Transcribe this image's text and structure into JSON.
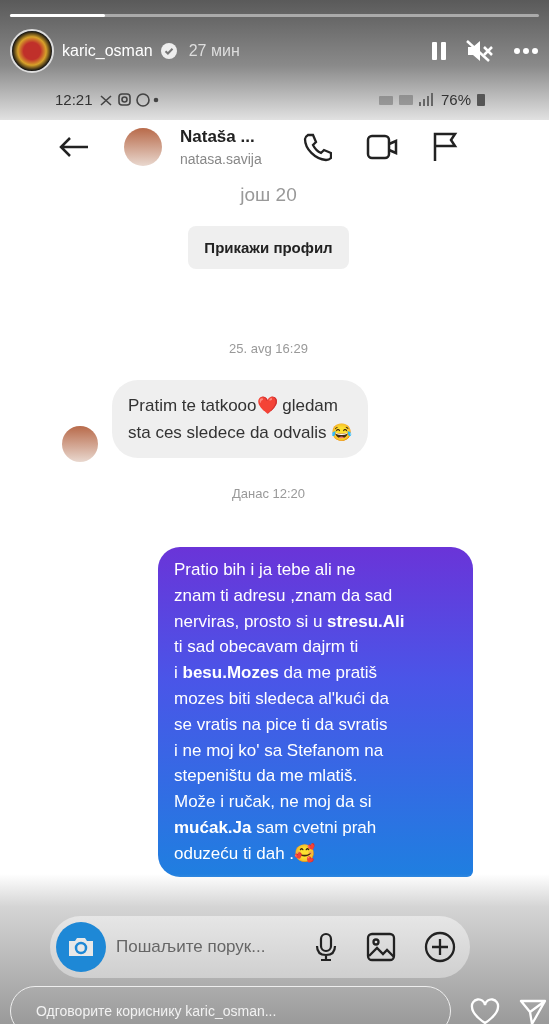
{
  "story": {
    "progress": {
      "level": 0.18
    },
    "username": "karic_osman",
    "verified": true,
    "time": "27 мин",
    "paused": false,
    "muted": true
  },
  "phone_status": {
    "time": "12:21",
    "battery": "76%"
  },
  "chat_header": {
    "name": "Nataša ...",
    "handle": "natasa.savija"
  },
  "profile_info": {
    "count": "још 20",
    "button": "Прикажи профил"
  },
  "messages": [
    {
      "kind": "date",
      "text": "25. avg 16:29"
    },
    {
      "kind": "incoming",
      "text": "Pratim te tatkooo❤️ gledam\nsta ces sledece da odvalis 😂"
    },
    {
      "kind": "date",
      "text": "Данас 12:20"
    },
    {
      "kind": "outgoing",
      "text": "Pratio bih i ja tebe ali ne\nznam ti adresu ,znam da  sad\nnerviras, prosto si u **stresu.Ali**\nti  sad obecavam dajrm  ti\ni **besu.Mozes** da me pratiš\nmozes biti sledeca al'kući da\nse vratis na pice ti da svratis\ni ne moj ko' sa Stefanom na\nstepeništu da me  mlatiš.\nMože i ručak, ne moj da si\n**mućak.Ja** sam cvetni prah\noduzeću ti dah .🥰"
    }
  ],
  "composer": {
    "placeholder": "Пошаљите порук..."
  },
  "reply": {
    "placeholder": "Одговорите кориснику karic_osman..."
  }
}
